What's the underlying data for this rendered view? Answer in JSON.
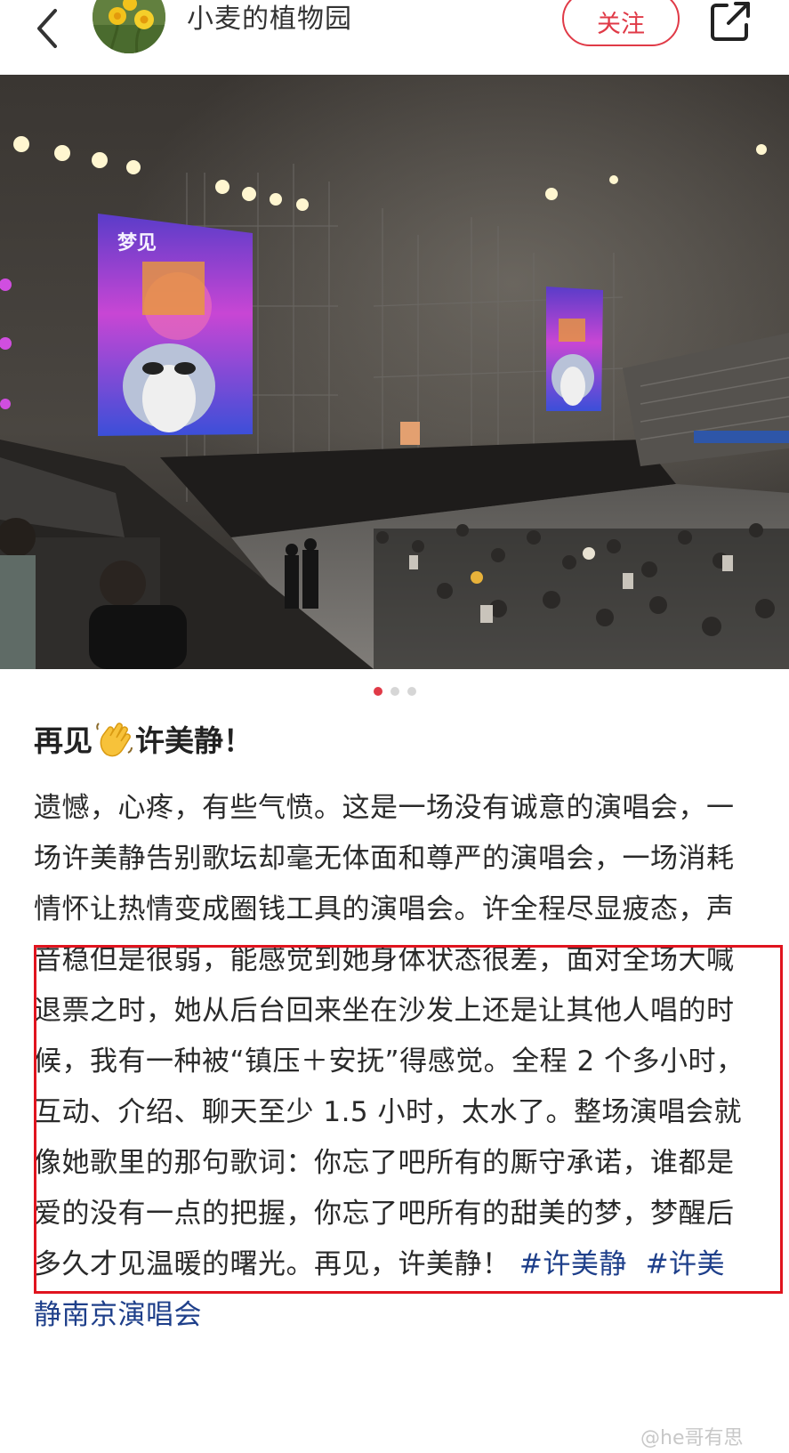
{
  "header": {
    "author_name": "小麦的植物园",
    "follow_label": "关注",
    "icons": {
      "back": "chevron-left-icon",
      "share": "share-icon"
    }
  },
  "photo": {
    "poster_text": "梦见",
    "scene": "concert-arena-stage-photo"
  },
  "pager": {
    "total": 3,
    "active_index": 0
  },
  "post": {
    "title_before_emoji": "再见",
    "title_emoji": "waving-hand",
    "title_after_emoji": "许美静！",
    "body_text": "遗憾，心疼，有些气愤。这是一场没有诚意的演唱会，一场许美静告别歌坛却毫无体面和尊严的演唱会，一场消耗情怀让热情变成圈钱工具的演唱会。许全程尽显疲态，声音稳但是很弱，能感觉到她身体状态很差，面对全场大喊退票之时，她从后台回来坐在沙发上还是让其他人唱的时候，我有一种被“镇压＋安抚”得感觉。全程 2 个多小时，互动、介绍、聊天至少 1.5 小时，太水了。整场演唱会就像她歌里的那句歌词：你忘了吧所有的厮守承诺，谁都是爱的没有一点的把握，你忘了吧所有的甜美的梦，梦醒后多久才见温暖的曙光。再见，许美静！ ",
    "hashtags": [
      "#许美静",
      "#许美静南京演唱会"
    ]
  },
  "watermark": "@he哥有思",
  "colors": {
    "accent": "#e03a47",
    "hashtag": "#1e3f8a",
    "highlight_border": "#e0141e"
  }
}
